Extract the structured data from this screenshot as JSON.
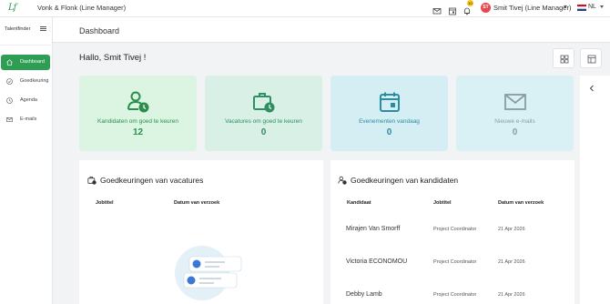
{
  "topbar": {
    "logo": "Lf",
    "company": "Vonk & Flonk (Line Manager)",
    "notification_count": "10",
    "user_initials": "ST",
    "user_name": "Smit Tivej (Line Manager)",
    "language": "NL"
  },
  "sidebar": {
    "brand": "Talentfinder",
    "items": [
      {
        "label": "Dashboard",
        "icon": "home-icon",
        "active": true
      },
      {
        "label": "Goedkeuring",
        "icon": "check-circle-icon",
        "active": false
      },
      {
        "label": "Agenda",
        "icon": "clock-icon",
        "active": false
      },
      {
        "label": "E-mails",
        "icon": "mail-icon",
        "active": false
      }
    ]
  },
  "header": {
    "title": "Dashboard"
  },
  "greeting": "Hallo, Smit Tivej !",
  "cards": [
    {
      "label": "Kandidaten om goed te keuren",
      "value": "12",
      "bg": "#dbf5e2",
      "color": "#2a8f4a",
      "icon": "user-clock-icon"
    },
    {
      "label": "Vacatures om goed te keuren",
      "value": "0",
      "bg": "#d8f0e6",
      "color": "#2f8f60",
      "icon": "briefcase-clock-icon"
    },
    {
      "label": "Evenementen vandaag",
      "value": "0",
      "bg": "#d5eef3",
      "color": "#2a8ea0",
      "icon": "calendar-icon"
    },
    {
      "label": "Nieuwe e-mails",
      "value": "0",
      "bg": "#d9f1f5",
      "color": "#8a9aa3",
      "icon": "envelope-icon"
    }
  ],
  "vacancies_panel": {
    "title": "Goedkeuringen van vacatures",
    "col_jobtitle": "Jobtitel",
    "col_date": "Datum van verzoek"
  },
  "candidates_panel": {
    "title": "Goedkeuringen van kandidaten",
    "col_candidate": "Kandidaat",
    "col_jobtitle": "Jobtitel",
    "col_date": "Datum van verzoek",
    "rows": [
      {
        "name": "Mirajen Van Smorff",
        "job": "Project Coordinator",
        "date": "21 Apr 2026"
      },
      {
        "name": "Victoria ECONOMOU",
        "job": "Project Coordinator",
        "date": "21 Apr 2026"
      },
      {
        "name": "Debby Lamb",
        "job": "Project Coordinator",
        "date": "21 Apr 2026"
      }
    ]
  }
}
